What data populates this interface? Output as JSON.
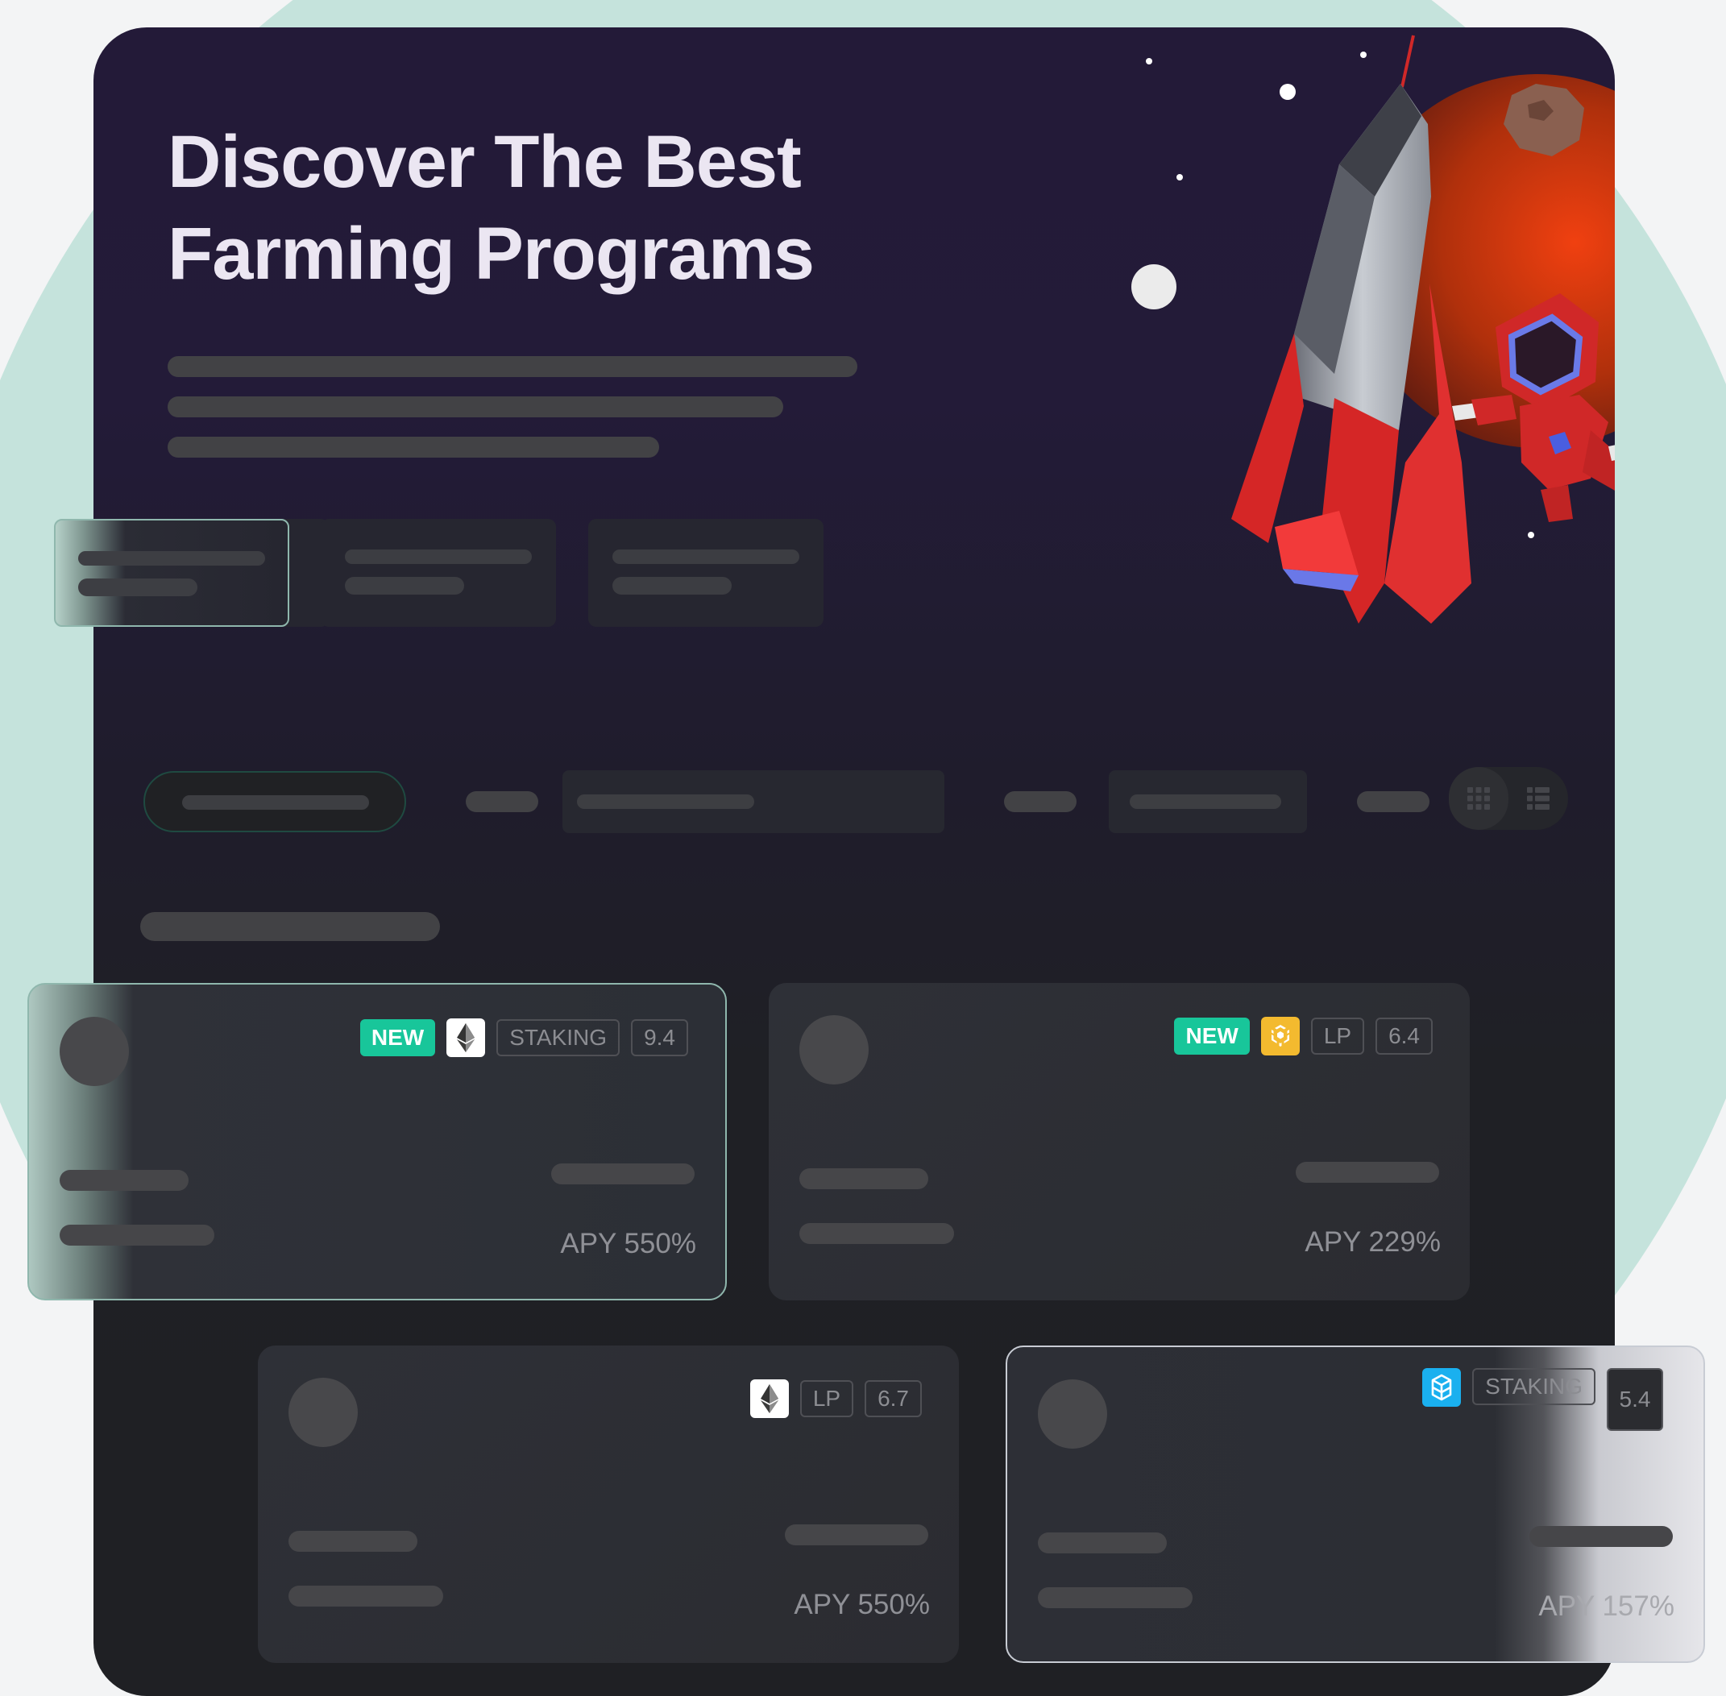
{
  "hero": {
    "title_line1": "Discover The Best",
    "title_line2": "Farming Programs"
  },
  "cards": [
    {
      "tags": {
        "new": "NEW",
        "chain": "ethereum-icon",
        "type": "STAKING",
        "score": "9.4"
      },
      "apy": "APY 550%"
    },
    {
      "tags": {
        "new": "NEW",
        "chain": "binance-icon",
        "type": "LP",
        "score": "6.4"
      },
      "apy": "APY 229%"
    },
    {
      "tags": {
        "chain": "ethereum-icon",
        "type": "LP",
        "score": "6.7"
      },
      "apy": "APY 550%"
    },
    {
      "tags": {
        "chain": "fantom-icon",
        "type": "STAKING",
        "score": "5.4"
      },
      "apy": "APY 157%"
    }
  ],
  "colors": {
    "panel_bg": "#231a38",
    "accent_green": "#18c69a",
    "binance_yellow": "#f3ba2f",
    "fantom_blue": "#1ab0ef",
    "bg_mint": "#c5e3dc"
  },
  "view_toggle": {
    "grid": "grid-view-icon",
    "list": "list-view-icon"
  }
}
